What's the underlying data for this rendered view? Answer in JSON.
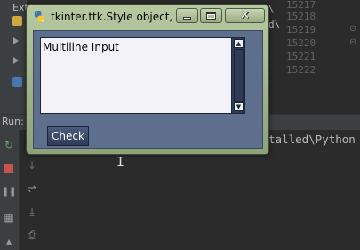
{
  "ide": {
    "project_label": "Ext",
    "line_numbers": [
      "15217",
      "15218",
      "15219",
      "15220",
      "15221",
      "15222"
    ],
    "editor_fragments": [
      "\\",
      "d\\"
    ],
    "run_tab_label": "Run:",
    "console_text": "talled\\Python"
  },
  "window": {
    "title": "tkinter.ttk.Style object, i...",
    "controls": {
      "minimize_icon": "minimize-icon",
      "maximize_icon": "maximize-icon",
      "close_glyph": "✕"
    }
  },
  "form": {
    "text_value": "Multiline Input",
    "scroll_up_glyph": "▲",
    "scroll_down_glyph": "▼",
    "check_label": "Check"
  },
  "colors": {
    "ide_background": "#2b2b2b",
    "ide_panel": "#3c3f41",
    "window_frame": "#a3b78e",
    "client_background": "#5e6f8e",
    "button_background": "#3b4b6a"
  }
}
